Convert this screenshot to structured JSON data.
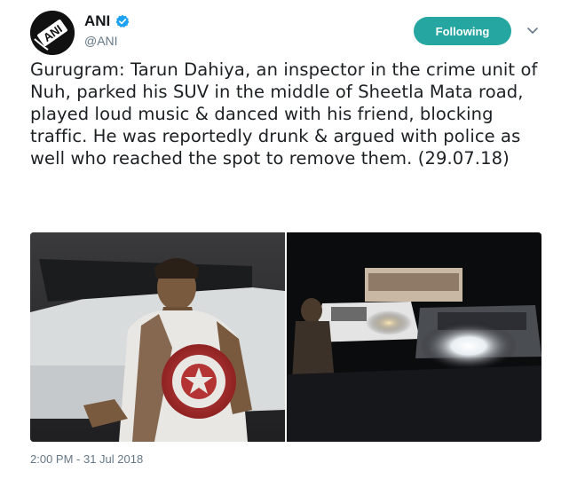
{
  "account": {
    "display_name": "ANI",
    "handle": "@ANI",
    "verified": true,
    "avatar_icon": "ani-logo-icon",
    "avatar_text": "ANI"
  },
  "follow_button": {
    "label": "Following",
    "color": "#26a6a1"
  },
  "menu": {
    "icon": "chevron-down-icon"
  },
  "tweet": {
    "text": "Gurugram: Tarun Dahiya, an inspector in the crime unit of Nuh, parked his SUV in the middle of Sheetla Mata road, played loud music & danced with his friend, blocking traffic. He was reportedly drunk & argued with police as well who reached the spot to remove them. (29.07.18)",
    "timestamp": "2:00 PM - 31 Jul 2018"
  },
  "media": {
    "count": 2,
    "tiles": [
      {
        "icon": "photo-man-captain-america-shirt"
      },
      {
        "icon": "photo-night-traffic-headlights"
      }
    ]
  },
  "colors": {
    "text": "#1c2022",
    "secondary": "#657786",
    "verified": "#1da1f2"
  }
}
